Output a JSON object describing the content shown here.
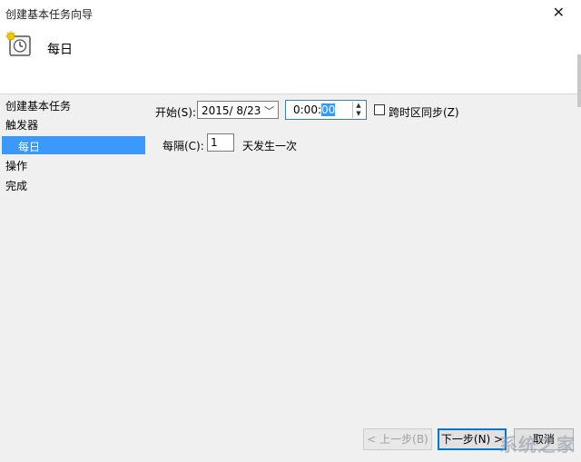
{
  "window": {
    "title": "创建基本任务向导",
    "close_glyph": "✕"
  },
  "header": {
    "title": "每日",
    "icon": "scheduled-task-clock-icon"
  },
  "sidebar": {
    "items": [
      {
        "label": "创建基本任务",
        "selected": false
      },
      {
        "label": "触发器",
        "selected": false
      },
      {
        "label": "每日",
        "selected": true
      },
      {
        "label": "操作",
        "selected": false
      },
      {
        "label": "完成",
        "selected": false
      }
    ]
  },
  "form": {
    "start_label": "开始(S):",
    "start_date": "2015/  8/23",
    "start_time_prefix": "0:00:",
    "start_time_selected": "00",
    "sync_timezone_label": "跨时区同步(Z)",
    "sync_timezone_checked": false,
    "recur_label": "每隔(C):",
    "recur_value": "1",
    "recur_suffix": "天发生一次"
  },
  "buttons": {
    "back": "< 上一步(B)",
    "next": "下一步(N) >",
    "cancel": "取消"
  },
  "colors": {
    "selection": "#3b99fc",
    "focus_border": "#0078d7"
  },
  "watermark": {
    "text": "系统之家"
  }
}
